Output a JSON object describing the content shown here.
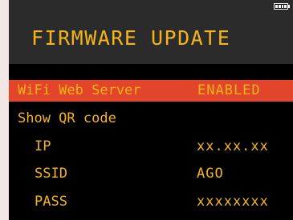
{
  "header": {
    "title": "FIRMWARE UPDATE",
    "battery_icon": "battery-full-icon"
  },
  "colors": {
    "text": "#f4b51a",
    "selected_background": "#e2452a",
    "header_background": "#2b2b2b",
    "screen_background": "#000000"
  },
  "menu": {
    "wifi_label": "WiFi Web Server",
    "wifi_value": "ENABLED",
    "qr_label": "Show QR code",
    "ip_label": "IP",
    "ip_value": "xx.xx.xx",
    "ssid_label": "SSID",
    "ssid_value": "AGO",
    "pass_label": "PASS",
    "pass_value": "xxxxxxxx"
  }
}
